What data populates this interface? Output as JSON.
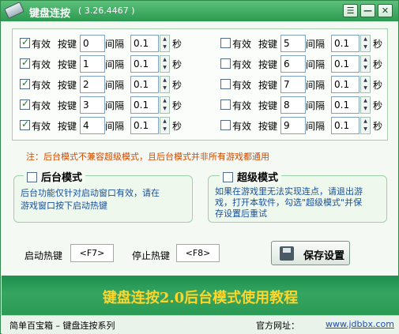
{
  "window": {
    "title": "键盘连按",
    "version": "( 3.26.4467 )",
    "menu_btn": "☰",
    "min_btn": "—",
    "close_btn": "✕"
  },
  "labels": {
    "valid": "有效",
    "key": "按键",
    "interval": "间隔",
    "sec": "秒"
  },
  "rows_left": [
    {
      "checked": true,
      "key": "0",
      "interval": "0.1"
    },
    {
      "checked": true,
      "key": "1",
      "interval": "0.1"
    },
    {
      "checked": true,
      "key": "2",
      "interval": "0.1"
    },
    {
      "checked": true,
      "key": "3",
      "interval": "0.1"
    },
    {
      "checked": true,
      "key": "4",
      "interval": "0.1"
    }
  ],
  "rows_right": [
    {
      "checked": false,
      "key": "5",
      "interval": "0.1"
    },
    {
      "checked": false,
      "key": "6",
      "interval": "0.1"
    },
    {
      "checked": false,
      "key": "7",
      "interval": "0.1"
    },
    {
      "checked": false,
      "key": "8",
      "interval": "0.1"
    },
    {
      "checked": false,
      "key": "9",
      "interval": "0.1"
    }
  ],
  "note": "注：后台模式不兼容超级模式，且后台模式并非所有游戏都通用",
  "bg_mode": {
    "title": "后台模式",
    "checked": false,
    "desc_line1": "后台功能仅针对启动窗口有效，请在",
    "desc_line2": "游戏窗口按下启动热键"
  },
  "super_mode": {
    "title": "超级模式",
    "checked": false,
    "desc_line1": "如果在游戏里无法实现连点，请退出游",
    "desc_line2": "戏，打开本软件，勾选\"超级模式\"并保",
    "desc_line3": "存设置后重试"
  },
  "hotkeys": {
    "start_label": "启动热键",
    "start_value": "<F7>",
    "stop_label": "停止热键",
    "stop_value": "<F8>"
  },
  "save_label": "保存设置",
  "banner": "键盘连按2.0后台模式使用教程",
  "status": {
    "left": "简单百宝箱 – 键盘连按系列",
    "site_label": "官方网址：",
    "site_url": "www.jdbbx.com"
  },
  "colors": {
    "accent": "#2c9a51",
    "note": "#d24a00",
    "banner_text": "#ffd52a"
  }
}
